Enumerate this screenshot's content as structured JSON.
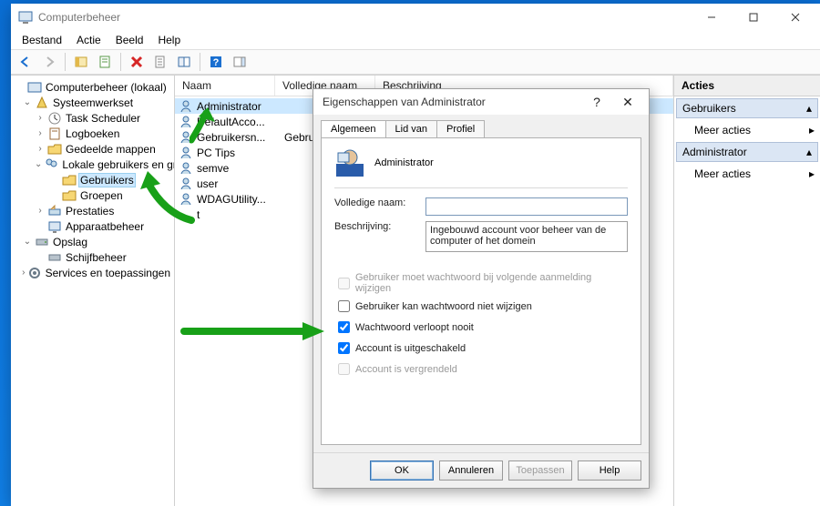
{
  "window": {
    "title": "Computerbeheer"
  },
  "menu": {
    "file": "Bestand",
    "action": "Actie",
    "view": "Beeld",
    "help": "Help"
  },
  "tree": {
    "root": "Computerbeheer (lokaal)",
    "systools": "Systeemwerkset",
    "tasksched": "Task Scheduler",
    "logs": "Logboeken",
    "sharedfolders": "Gedeelde mappen",
    "localusers": "Lokale gebruikers en gro…",
    "users": "Gebruikers",
    "groups": "Groepen",
    "perf": "Prestaties",
    "devmgr": "Apparaatbeheer",
    "storage": "Opslag",
    "diskmgmt": "Schijfbeheer",
    "services": "Services en toepassingen"
  },
  "list": {
    "col_name": "Naam",
    "col_fullname": "Volledige naam",
    "col_desc": "Beschrijving",
    "rows": [
      {
        "name": "Administrator"
      },
      {
        "name": "DefaultAcco..."
      },
      {
        "name": "Gebruikersn...",
        "full": "Gebruikersn..."
      },
      {
        "name": "PC Tips"
      },
      {
        "name": "semve"
      },
      {
        "name": "user"
      },
      {
        "name": "WDAGUtility..."
      },
      {
        "name": "t"
      }
    ]
  },
  "actions": {
    "header": "Acties",
    "sec1": "Gebruikers",
    "more": "Meer acties",
    "sec2": "Administrator"
  },
  "dlg": {
    "title": "Eigenschappen van Administrator",
    "tab_general": "Algemeen",
    "tab_member": "Lid van",
    "tab_profile": "Profiel",
    "username": "Administrator",
    "lbl_full": "Volledige naam:",
    "val_full": "",
    "lbl_desc": "Beschrijving:",
    "val_desc": "Ingebouwd account voor beheer van de computer of het domein",
    "chk_must_change": "Gebruiker moet wachtwoord bij volgende aanmelding wijzigen",
    "chk_cannot_change": "Gebruiker kan wachtwoord niet wijzigen",
    "chk_never_expires": "Wachtwoord verloopt nooit",
    "chk_disabled": "Account is uitgeschakeld",
    "chk_locked": "Account is vergrendeld",
    "btn_ok": "OK",
    "btn_cancel": "Annuleren",
    "btn_apply": "Toepassen",
    "btn_help": "Help"
  }
}
